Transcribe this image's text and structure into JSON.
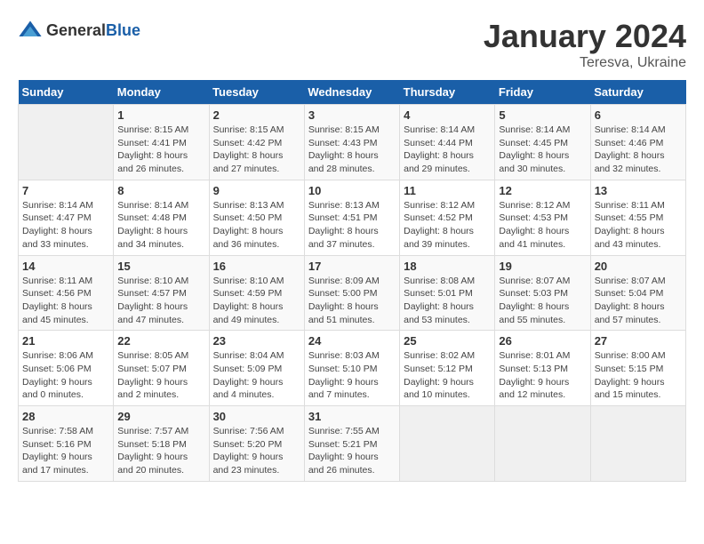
{
  "logo": {
    "general": "General",
    "blue": "Blue"
  },
  "title": "January 2024",
  "location": "Teresva, Ukraine",
  "days_header": [
    "Sunday",
    "Monday",
    "Tuesday",
    "Wednesday",
    "Thursday",
    "Friday",
    "Saturday"
  ],
  "weeks": [
    [
      {
        "day": "",
        "empty": true
      },
      {
        "day": "1",
        "sunrise": "Sunrise: 8:15 AM",
        "sunset": "Sunset: 4:41 PM",
        "daylight": "Daylight: 8 hours and 26 minutes."
      },
      {
        "day": "2",
        "sunrise": "Sunrise: 8:15 AM",
        "sunset": "Sunset: 4:42 PM",
        "daylight": "Daylight: 8 hours and 27 minutes."
      },
      {
        "day": "3",
        "sunrise": "Sunrise: 8:15 AM",
        "sunset": "Sunset: 4:43 PM",
        "daylight": "Daylight: 8 hours and 28 minutes."
      },
      {
        "day": "4",
        "sunrise": "Sunrise: 8:14 AM",
        "sunset": "Sunset: 4:44 PM",
        "daylight": "Daylight: 8 hours and 29 minutes."
      },
      {
        "day": "5",
        "sunrise": "Sunrise: 8:14 AM",
        "sunset": "Sunset: 4:45 PM",
        "daylight": "Daylight: 8 hours and 30 minutes."
      },
      {
        "day": "6",
        "sunrise": "Sunrise: 8:14 AM",
        "sunset": "Sunset: 4:46 PM",
        "daylight": "Daylight: 8 hours and 32 minutes."
      }
    ],
    [
      {
        "day": "7",
        "sunrise": "Sunrise: 8:14 AM",
        "sunset": "Sunset: 4:47 PM",
        "daylight": "Daylight: 8 hours and 33 minutes."
      },
      {
        "day": "8",
        "sunrise": "Sunrise: 8:14 AM",
        "sunset": "Sunset: 4:48 PM",
        "daylight": "Daylight: 8 hours and 34 minutes."
      },
      {
        "day": "9",
        "sunrise": "Sunrise: 8:13 AM",
        "sunset": "Sunset: 4:50 PM",
        "daylight": "Daylight: 8 hours and 36 minutes."
      },
      {
        "day": "10",
        "sunrise": "Sunrise: 8:13 AM",
        "sunset": "Sunset: 4:51 PM",
        "daylight": "Daylight: 8 hours and 37 minutes."
      },
      {
        "day": "11",
        "sunrise": "Sunrise: 8:12 AM",
        "sunset": "Sunset: 4:52 PM",
        "daylight": "Daylight: 8 hours and 39 minutes."
      },
      {
        "day": "12",
        "sunrise": "Sunrise: 8:12 AM",
        "sunset": "Sunset: 4:53 PM",
        "daylight": "Daylight: 8 hours and 41 minutes."
      },
      {
        "day": "13",
        "sunrise": "Sunrise: 8:11 AM",
        "sunset": "Sunset: 4:55 PM",
        "daylight": "Daylight: 8 hours and 43 minutes."
      }
    ],
    [
      {
        "day": "14",
        "sunrise": "Sunrise: 8:11 AM",
        "sunset": "Sunset: 4:56 PM",
        "daylight": "Daylight: 8 hours and 45 minutes."
      },
      {
        "day": "15",
        "sunrise": "Sunrise: 8:10 AM",
        "sunset": "Sunset: 4:57 PM",
        "daylight": "Daylight: 8 hours and 47 minutes."
      },
      {
        "day": "16",
        "sunrise": "Sunrise: 8:10 AM",
        "sunset": "Sunset: 4:59 PM",
        "daylight": "Daylight: 8 hours and 49 minutes."
      },
      {
        "day": "17",
        "sunrise": "Sunrise: 8:09 AM",
        "sunset": "Sunset: 5:00 PM",
        "daylight": "Daylight: 8 hours and 51 minutes."
      },
      {
        "day": "18",
        "sunrise": "Sunrise: 8:08 AM",
        "sunset": "Sunset: 5:01 PM",
        "daylight": "Daylight: 8 hours and 53 minutes."
      },
      {
        "day": "19",
        "sunrise": "Sunrise: 8:07 AM",
        "sunset": "Sunset: 5:03 PM",
        "daylight": "Daylight: 8 hours and 55 minutes."
      },
      {
        "day": "20",
        "sunrise": "Sunrise: 8:07 AM",
        "sunset": "Sunset: 5:04 PM",
        "daylight": "Daylight: 8 hours and 57 minutes."
      }
    ],
    [
      {
        "day": "21",
        "sunrise": "Sunrise: 8:06 AM",
        "sunset": "Sunset: 5:06 PM",
        "daylight": "Daylight: 9 hours and 0 minutes."
      },
      {
        "day": "22",
        "sunrise": "Sunrise: 8:05 AM",
        "sunset": "Sunset: 5:07 PM",
        "daylight": "Daylight: 9 hours and 2 minutes."
      },
      {
        "day": "23",
        "sunrise": "Sunrise: 8:04 AM",
        "sunset": "Sunset: 5:09 PM",
        "daylight": "Daylight: 9 hours and 4 minutes."
      },
      {
        "day": "24",
        "sunrise": "Sunrise: 8:03 AM",
        "sunset": "Sunset: 5:10 PM",
        "daylight": "Daylight: 9 hours and 7 minutes."
      },
      {
        "day": "25",
        "sunrise": "Sunrise: 8:02 AM",
        "sunset": "Sunset: 5:12 PM",
        "daylight": "Daylight: 9 hours and 10 minutes."
      },
      {
        "day": "26",
        "sunrise": "Sunrise: 8:01 AM",
        "sunset": "Sunset: 5:13 PM",
        "daylight": "Daylight: 9 hours and 12 minutes."
      },
      {
        "day": "27",
        "sunrise": "Sunrise: 8:00 AM",
        "sunset": "Sunset: 5:15 PM",
        "daylight": "Daylight: 9 hours and 15 minutes."
      }
    ],
    [
      {
        "day": "28",
        "sunrise": "Sunrise: 7:58 AM",
        "sunset": "Sunset: 5:16 PM",
        "daylight": "Daylight: 9 hours and 17 minutes."
      },
      {
        "day": "29",
        "sunrise": "Sunrise: 7:57 AM",
        "sunset": "Sunset: 5:18 PM",
        "daylight": "Daylight: 9 hours and 20 minutes."
      },
      {
        "day": "30",
        "sunrise": "Sunrise: 7:56 AM",
        "sunset": "Sunset: 5:20 PM",
        "daylight": "Daylight: 9 hours and 23 minutes."
      },
      {
        "day": "31",
        "sunrise": "Sunrise: 7:55 AM",
        "sunset": "Sunset: 5:21 PM",
        "daylight": "Daylight: 9 hours and 26 minutes."
      },
      {
        "day": "",
        "empty": true
      },
      {
        "day": "",
        "empty": true
      },
      {
        "day": "",
        "empty": true
      }
    ]
  ]
}
